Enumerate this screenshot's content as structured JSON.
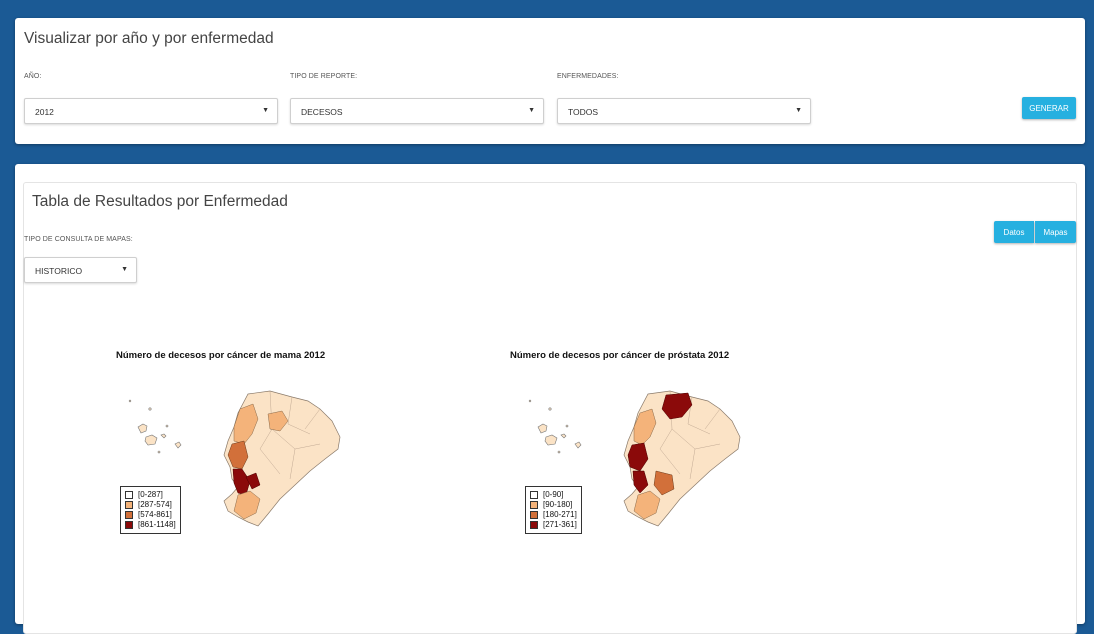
{
  "filters_panel": {
    "title": "Visualizar por año y por enfermedad",
    "year_label": "AÑO:",
    "year_value": "2012",
    "report_label": "TIPO DE REPORTE:",
    "report_value": "DECESOS",
    "disease_label": "ENFERMEDADES:",
    "disease_value": "TODOS",
    "generate_label": "GENERAR"
  },
  "results_panel": {
    "title": "Tabla de Resultados por Enfermedad",
    "map_query_label": "TIPO DE CONSULTA DE MAPAS:",
    "map_query_value": "HISTORICO",
    "data_button": "Datos",
    "maps_button": "Mapas"
  },
  "maps": [
    {
      "title": "Número de decesos por cáncer de mama 2012",
      "legend": [
        "[0-287]",
        "[287-574]",
        "[574-861]",
        "[861-1148]"
      ]
    },
    {
      "title": "Número de decesos por cáncer de próstata 2012",
      "legend": [
        "[0-90]",
        "[90-180]",
        "[180-271]",
        "[271-361]"
      ]
    }
  ],
  "colors": {
    "class_1": "#ffffff",
    "class_2": "#f4b37a",
    "class_3": "#d2703a",
    "class_4": "#8b0a0a",
    "base_fill": "#fbe3c6",
    "accent": "#26b0e0",
    "background": "#1b5a95"
  },
  "icons": {
    "dropdown": "caret-down-icon"
  }
}
